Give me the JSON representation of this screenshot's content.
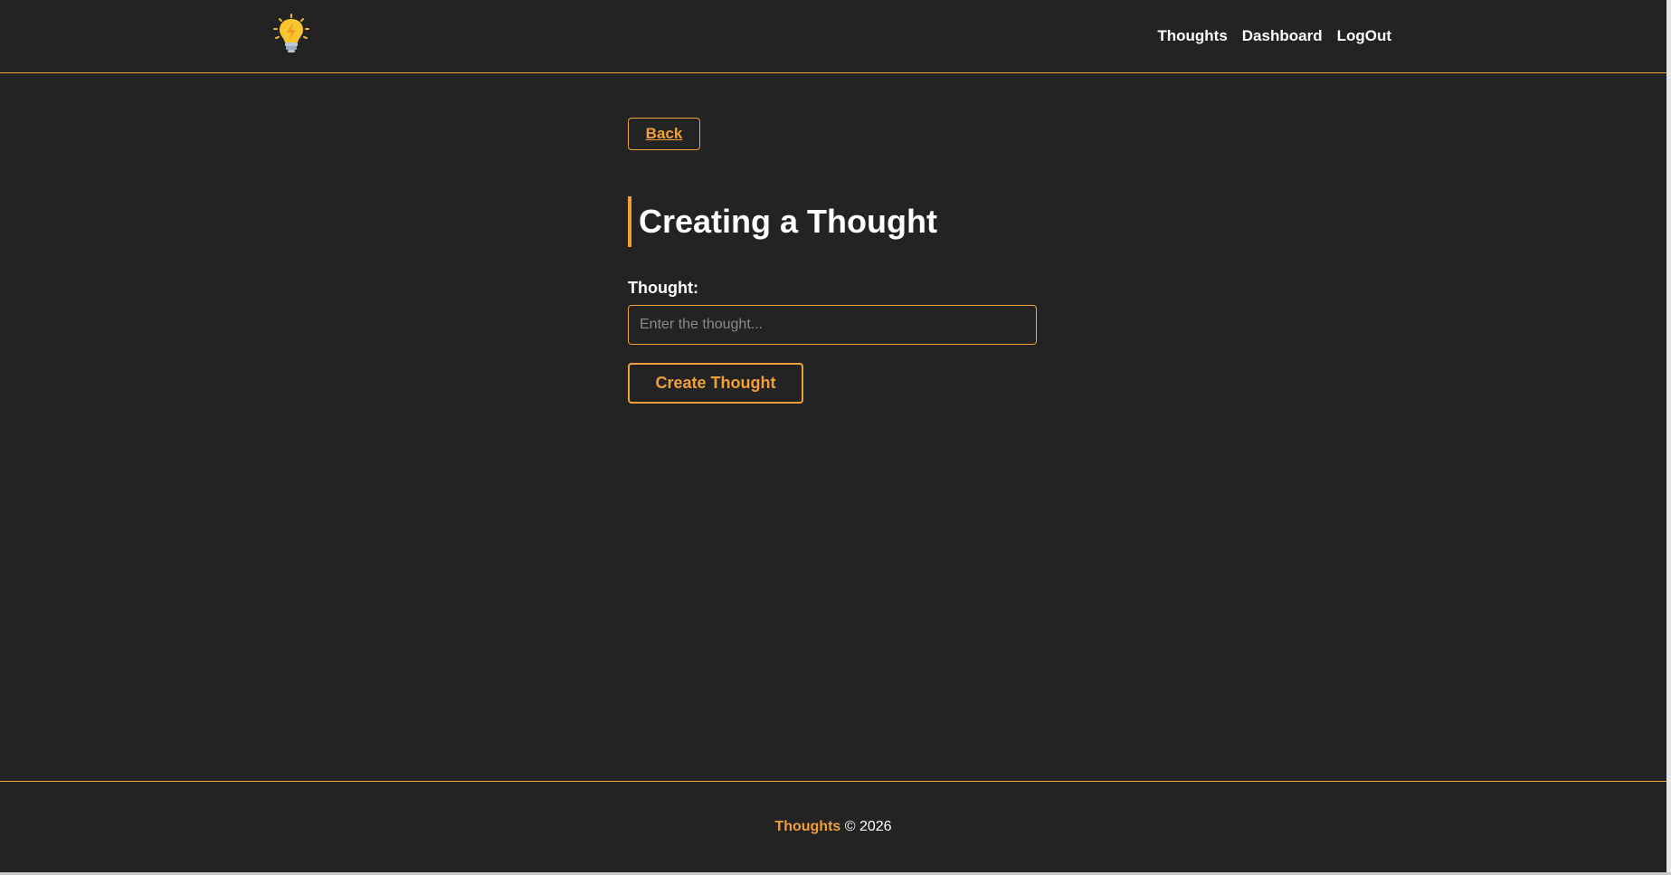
{
  "header": {
    "logo_icon": "lightbulb-icon",
    "nav": {
      "thoughts": "Thoughts",
      "dashboard": "Dashboard",
      "logout": "LogOut"
    }
  },
  "main": {
    "back_label": "Back",
    "title": "Creating a Thought",
    "form": {
      "label": "Thought:",
      "value": "",
      "placeholder": "Enter the thought...",
      "submit_label": "Create Thought"
    }
  },
  "footer": {
    "brand": "Thoughts",
    "copyright": "© 2026"
  },
  "colors": {
    "background": "#232323",
    "accent": "#f0a03a",
    "text": "#ffffff",
    "placeholder": "#8a8a8a"
  }
}
